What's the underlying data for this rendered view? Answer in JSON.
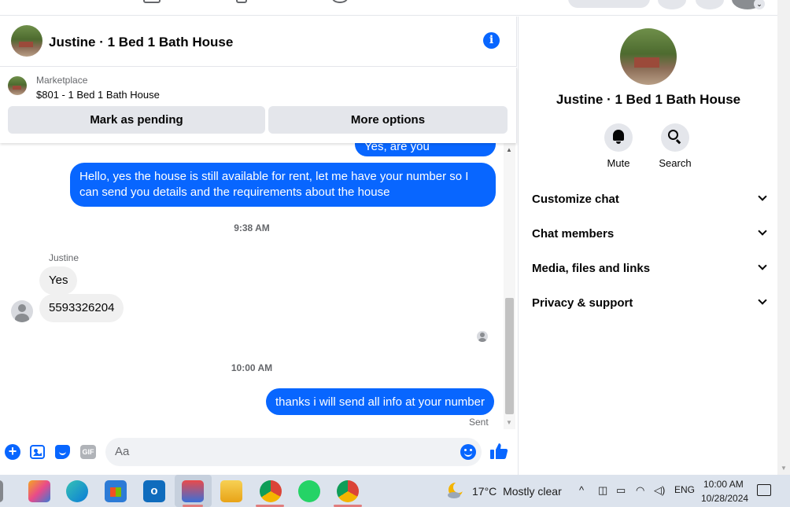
{
  "chat": {
    "title": "Justine · 1 Bed 1 Bath House",
    "marketplace_label": "Marketplace",
    "listing": "$801 - 1 Bed 1 Bath House",
    "mark_pending": "Mark as pending",
    "more_options": "More options"
  },
  "messages": {
    "cut_off": "Yes, are you interested?",
    "long_reply": "Hello, yes the house is still available for rent, let me have your number so I can send you details and the requirements about the house",
    "time1": "9:38 AM",
    "sender": "Justine",
    "reply1": "Yes",
    "reply2": "5593326204",
    "time2": "10:00 AM",
    "last": "thanks i will send all info at your number",
    "status": "Sent"
  },
  "composer": {
    "placeholder": "Aa",
    "gif": "GIF"
  },
  "side": {
    "title": "Justine · 1 Bed 1 Bath House",
    "mute": "Mute",
    "search": "Search",
    "sections": [
      "Customize chat",
      "Chat members",
      "Media, files and links",
      "Privacy & support"
    ]
  },
  "taskbar": {
    "temperature": "17°C",
    "weather": "Mostly clear",
    "lang": "ENG",
    "time": "10:00 AM",
    "date": "10/28/2024"
  },
  "colors": {
    "accent": "#0866ff",
    "bubble_in": "#f0f0f0",
    "taskbar": "#dce3ed"
  }
}
